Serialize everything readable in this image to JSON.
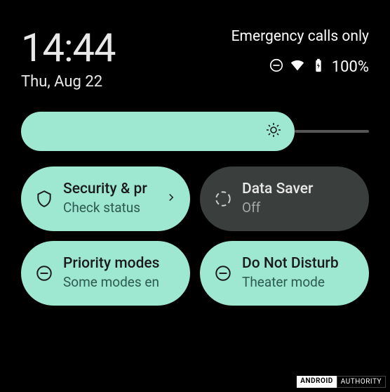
{
  "status": {
    "time": "14:44",
    "date": "Thu, Aug 22",
    "network_text": "Emergency calls only",
    "battery_percent": "100%"
  },
  "tiles": {
    "security": {
      "title": "Security & pr",
      "subtitle": "Check status"
    },
    "data_saver": {
      "title": "Data Saver",
      "subtitle": "Off"
    },
    "priority": {
      "title": "Priority modes",
      "subtitle": "Some modes en"
    },
    "dnd": {
      "title": "Do Not Disturb",
      "subtitle": "Theater mode"
    }
  },
  "watermark": {
    "brand1": "ANDROID",
    "brand2": "AUTHORITY"
  }
}
